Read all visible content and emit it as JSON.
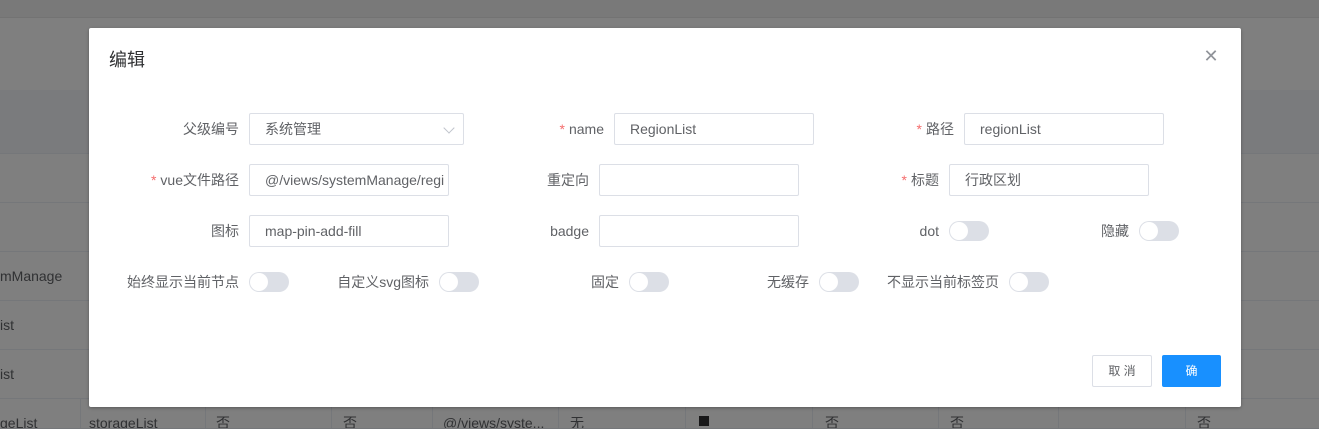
{
  "background_table": {
    "rows": [
      {
        "col0": "mManage",
        "cells": []
      },
      {
        "col0": "ist",
        "cells": []
      },
      {
        "col0": "ist",
        "cells": []
      },
      {
        "col0": "geList",
        "cells": [
          "storageList",
          "否",
          "否",
          "@/views/syste...",
          "无",
          "",
          "否",
          "否",
          "",
          "否"
        ]
      }
    ]
  },
  "dialog": {
    "title": "编辑",
    "close_icon": "close-icon",
    "fields": {
      "parent_id": {
        "label": "父级编号",
        "value": "系统管理"
      },
      "name": {
        "label": "name",
        "value": "RegionList",
        "required": true
      },
      "path": {
        "label": "路径",
        "value": "regionList",
        "required": true
      },
      "vue_path": {
        "label": "vue文件路径",
        "value": "@/views/systemManage/regi",
        "required": true
      },
      "redirect": {
        "label": "重定向",
        "value": ""
      },
      "title": {
        "label": "标题",
        "value": "行政区划",
        "required": true
      },
      "icon": {
        "label": "图标",
        "value": "map-pin-add-fill"
      },
      "badge": {
        "label": "badge",
        "value": ""
      },
      "dot": {
        "label": "dot",
        "on": false
      },
      "hidden": {
        "label": "隐藏",
        "on": false
      },
      "always_show": {
        "label": "始终显示当前节点",
        "on": false
      },
      "custom_svg": {
        "label": "自定义svg图标",
        "on": false
      },
      "affix": {
        "label": "固定",
        "on": false
      },
      "no_cache": {
        "label": "无缓存",
        "on": false
      },
      "no_tags_view": {
        "label": "不显示当前标签页",
        "on": false
      }
    },
    "buttons": {
      "cancel": "取 消",
      "confirm": "确 定"
    }
  },
  "colors": {
    "primary": "#1890ff",
    "required": "#f56c6c",
    "switch_off": "#dcdfe6"
  }
}
